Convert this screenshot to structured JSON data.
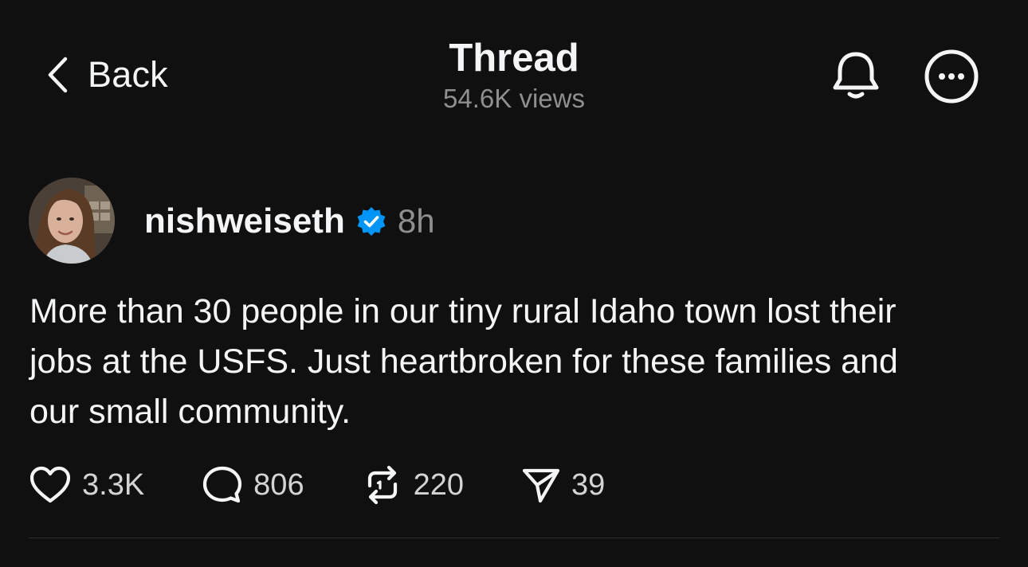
{
  "header": {
    "back_label": "Back",
    "title": "Thread",
    "views": "54.6K views"
  },
  "post": {
    "username": "nishweiseth",
    "timestamp": "8h",
    "text": "More than 30 people in our tiny rural Idaho town lost their\njobs at the USFS. Just heartbroken for these families and\nour small community.",
    "likes": "3.3K",
    "replies": "806",
    "reposts": "220",
    "shares": "39"
  },
  "icons": {
    "back": "chevron-left-icon",
    "bell": "bell-icon",
    "more": "more-circle-icon",
    "verified": "verified-badge-icon",
    "like": "heart-icon",
    "reply": "speech-bubble-icon",
    "repost": "repost-icon",
    "share": "send-icon"
  },
  "colors": {
    "background": "#101010",
    "text": "#f3f5f7",
    "secondary": "#8f8f8f",
    "verified": "#0095f6"
  }
}
